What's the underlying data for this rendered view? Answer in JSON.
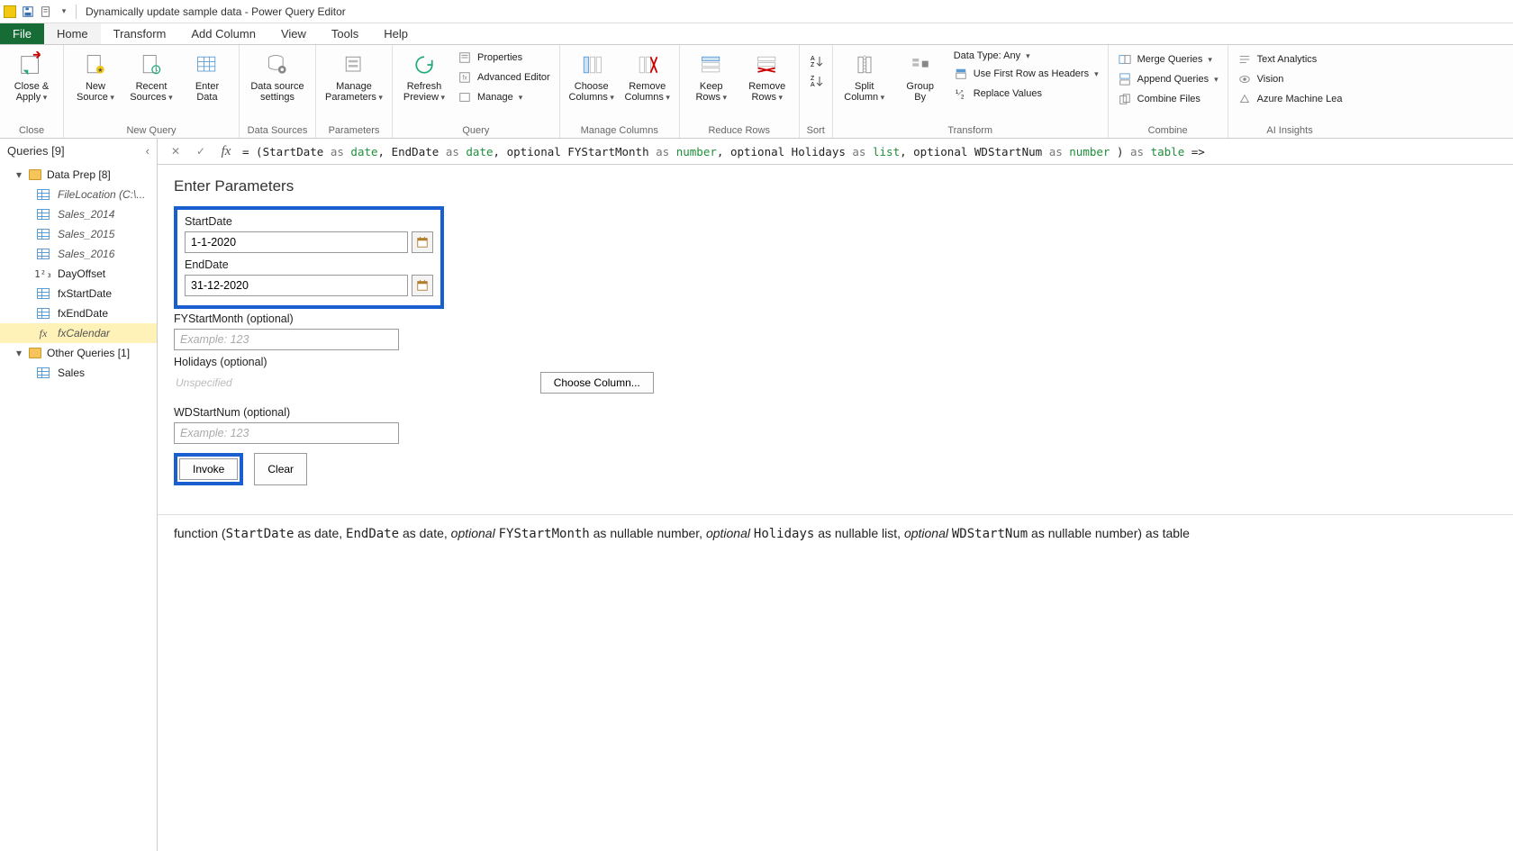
{
  "titlebar": {
    "title": "Dynamically update sample data - Power Query Editor"
  },
  "tabs": {
    "file": "File",
    "home": "Home",
    "transform": "Transform",
    "addColumn": "Add Column",
    "view": "View",
    "tools": "Tools",
    "help": "Help"
  },
  "ribbon": {
    "close": {
      "closeApply": "Close &\nApply",
      "group": "Close"
    },
    "newQuery": {
      "newSource": "New\nSource",
      "recentSources": "Recent\nSources",
      "enterData": "Enter\nData",
      "group": "New Query"
    },
    "dataSources": {
      "settings": "Data source\nsettings",
      "group": "Data Sources"
    },
    "parameters": {
      "manage": "Manage\nParameters",
      "group": "Parameters"
    },
    "query": {
      "refresh": "Refresh\nPreview",
      "properties": "Properties",
      "advEditor": "Advanced Editor",
      "manage": "Manage",
      "group": "Query"
    },
    "manageCols": {
      "choose": "Choose\nColumns",
      "remove": "Remove\nColumns",
      "group": "Manage Columns"
    },
    "reduceRows": {
      "keep": "Keep\nRows",
      "remove": "Remove\nRows",
      "group": "Reduce Rows"
    },
    "sort": {
      "group": "Sort"
    },
    "transform": {
      "split": "Split\nColumn",
      "groupBy": "Group\nBy",
      "dataType": "Data Type: Any",
      "firstRow": "Use First Row as Headers",
      "replace": "Replace Values",
      "group": "Transform"
    },
    "combine": {
      "merge": "Merge Queries",
      "append": "Append Queries",
      "combineFiles": "Combine Files",
      "group": "Combine"
    },
    "ai": {
      "text": "Text Analytics",
      "vision": "Vision",
      "azure": "Azure Machine Lea",
      "group": "AI Insights"
    }
  },
  "queriesPane": {
    "header": "Queries [9]",
    "groups": [
      {
        "label": "Data Prep [8]"
      },
      {
        "label": "Other Queries [1]"
      }
    ],
    "group1Items": [
      {
        "label": "FileLocation (C:\\...",
        "icon": "table",
        "italic": true
      },
      {
        "label": "Sales_2014",
        "icon": "table",
        "italic": true
      },
      {
        "label": "Sales_2015",
        "icon": "table",
        "italic": true
      },
      {
        "label": "Sales_2016",
        "icon": "table",
        "italic": true
      },
      {
        "label": "DayOffset",
        "icon": "num",
        "italic": false
      },
      {
        "label": "fxStartDate",
        "icon": "table",
        "italic": false
      },
      {
        "label": "fxEndDate",
        "icon": "table",
        "italic": false
      },
      {
        "label": "fxCalendar",
        "icon": "fx",
        "italic": true,
        "selected": true
      }
    ],
    "group2Items": [
      {
        "label": "Sales",
        "icon": "table",
        "italic": false
      }
    ]
  },
  "formulaBar": {
    "prefix": "= (StartDate ",
    "p1as": "as",
    "p1type": " date",
    "sep1": ", EndDate ",
    "p2as": "as",
    "p2type": " date",
    "sep2": ", optional FYStartMonth ",
    "p3as": "as",
    "p3type": " number",
    "sep3": ", optional Holidays ",
    "p4as": "as",
    "p4type": " list",
    "sep4": ", optional WDStartNum ",
    "p5as": "as",
    "p5type": " number",
    "suffix1": " ) ",
    "retAs": "as",
    "retType": " table",
    "suffix2": " =>"
  },
  "params": {
    "title": "Enter Parameters",
    "startDateLabel": "StartDate",
    "startDateValue": "1-1-2020",
    "endDateLabel": "EndDate",
    "endDateValue": "31-12-2020",
    "fyLabel": "FYStartMonth (optional)",
    "fyPlaceholder": "Example: 123",
    "holidaysLabel": "Holidays (optional)",
    "holidaysUnspec": "Unspecified",
    "chooseColumn": "Choose Column...",
    "wdLabel": "WDStartNum (optional)",
    "wdPlaceholder": "Example: 123",
    "invoke": "Invoke",
    "clear": "Clear"
  },
  "signature": {
    "prefix": "function (",
    "p1": "StartDate",
    "p1rest": " as date, ",
    "p2": "EndDate",
    "p2rest": " as date, ",
    "opt": "optional ",
    "p3": "FYStartMonth",
    "p3rest": " as nullable number, ",
    "p4": "Holidays",
    "p4rest": " as nullable list, ",
    "p5": "WDStartNum",
    "p5rest": " as nullable number) as table"
  }
}
